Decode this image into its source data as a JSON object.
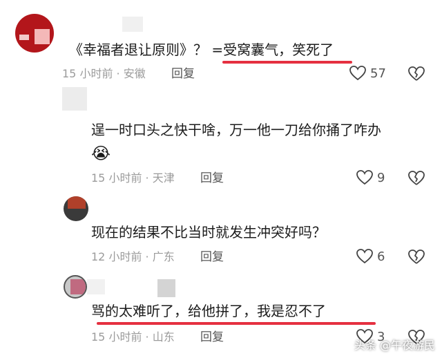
{
  "comments": [
    {
      "text": "《幸福者退让原则》？ =受窝囊气，笑死了",
      "time": "15 小时前 · 安徽",
      "reply": "回复",
      "likes": "57"
    },
    {
      "text": "逞一时口头之快干啥，万一他一刀给你捅了咋办",
      "emoji": "😭",
      "time": "15 小时前 · 天津",
      "reply": "回复",
      "likes": "9"
    },
    {
      "text": "现在的结果不比当时就发生冲突好吗？",
      "time": "12 小时前 · 广东",
      "reply": "回复",
      "likes": "6"
    },
    {
      "text": "骂的太难听了，给他拼了，我是忍不了",
      "time": "15 小时前 · 山东",
      "reply": "回复",
      "likes": "3"
    }
  ],
  "watermark": "头条 @午夜游民",
  "icons": {
    "like": "heart-outline-icon",
    "dislike": "broken-heart-icon"
  },
  "colors": {
    "underline": "#e53040",
    "meta": "#9b9b9b"
  }
}
